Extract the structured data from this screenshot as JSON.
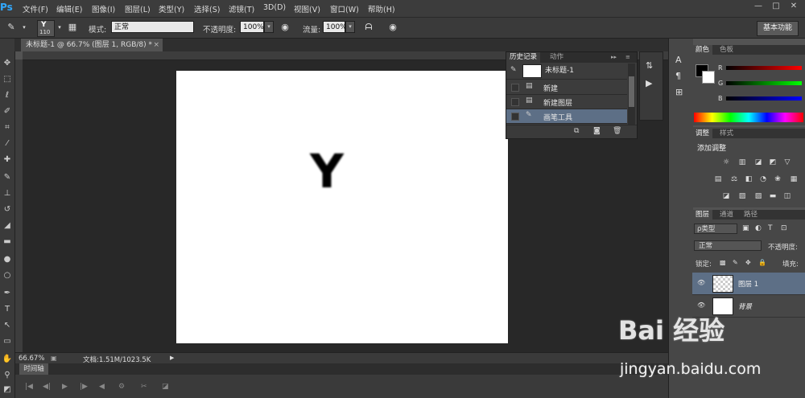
{
  "app": {
    "logo": "Ps"
  },
  "menu": [
    "文件(F)",
    "编辑(E)",
    "图像(I)",
    "图层(L)",
    "类型(Y)",
    "选择(S)",
    "滤镜(T)",
    "3D(D)",
    "视图(V)",
    "窗口(W)",
    "帮助(H)"
  ],
  "window_controls": [
    "—",
    "□",
    "✕"
  ],
  "options": {
    "brush_size": "110",
    "mode_label": "模式:",
    "mode_value": "正常",
    "opacity_label": "不透明度:",
    "opacity_value": "100%",
    "flow_label": "流量:",
    "flow_value": "100%",
    "workspace": "基本功能"
  },
  "document": {
    "tab_title": "未标题-1 @ 66.7% (图层 1, RGB/8) *",
    "zoom": "66.67%",
    "doc_info": "文档:1.51M/1023.5K",
    "canvas_glyph": "Y"
  },
  "timeline": {
    "tab": "时间轴"
  },
  "history": {
    "tabs": [
      "历史记录",
      "动作"
    ],
    "snapshot": "未标题-1",
    "items": [
      "新建",
      "新建图层",
      "画笔工具"
    ]
  },
  "color_panel": {
    "tabs": [
      "颜色",
      "色板"
    ],
    "channels": [
      "R",
      "G",
      "B"
    ]
  },
  "adjust_panel": {
    "tabs": [
      "调整",
      "样式"
    ],
    "title": "添加调整"
  },
  "layers_panel": {
    "tabs": [
      "图层",
      "通道",
      "路径"
    ],
    "filter": "ρ类型",
    "blend": "正常",
    "opacity_label": "不透明度:",
    "lock_label": "锁定:",
    "fill_label": "填充:",
    "layers": [
      "图层 1",
      "背景"
    ]
  },
  "watermark": {
    "logo": "Bai 经验",
    "url": "jingyan.baidu.com"
  }
}
